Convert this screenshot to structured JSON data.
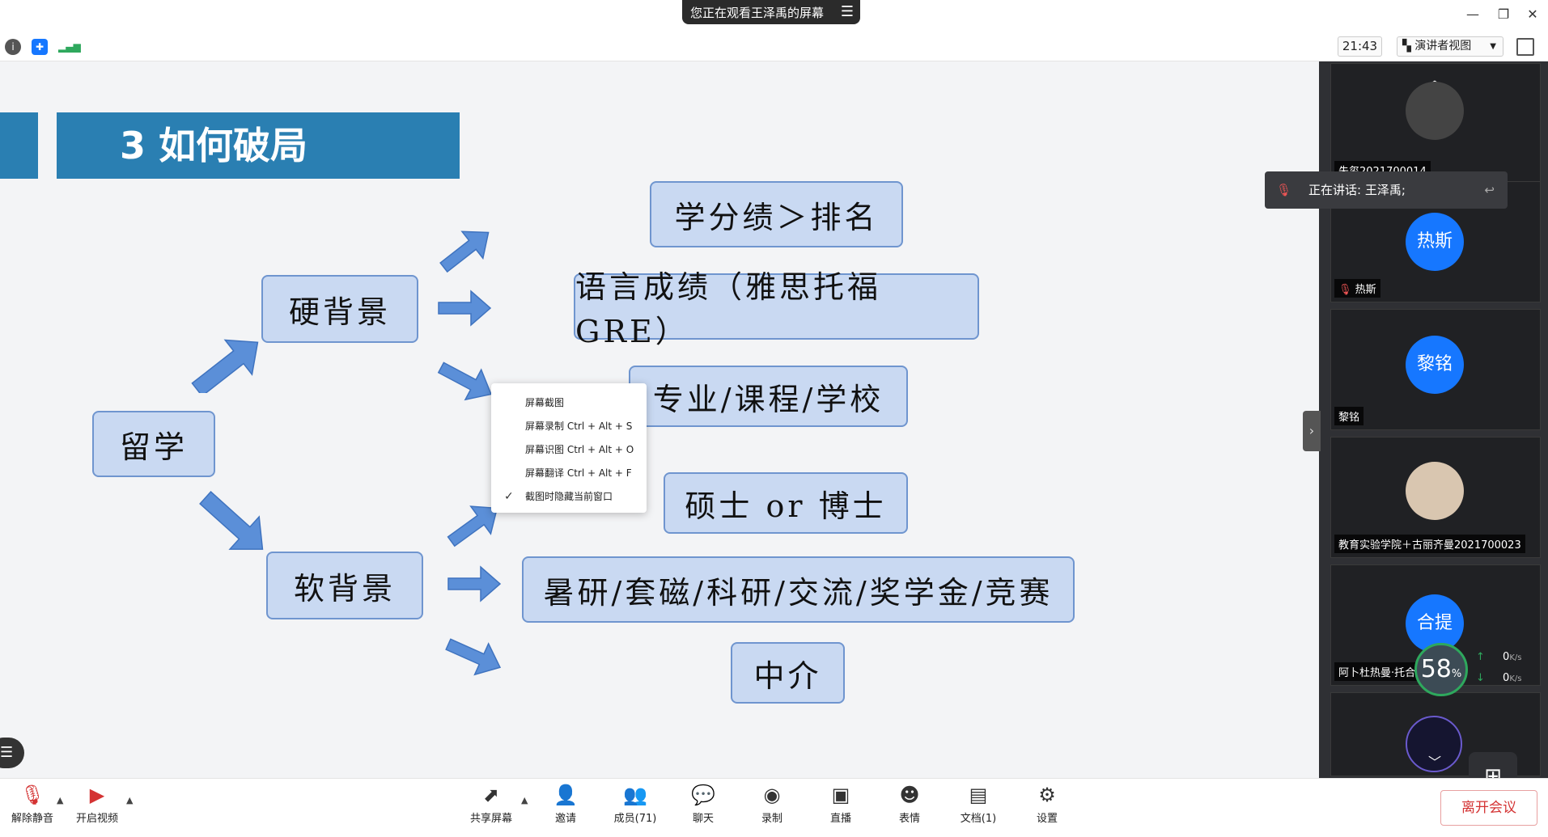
{
  "top": {
    "sharing_banner": "您正在观看王泽禹的屏幕",
    "clock": "21:43",
    "view_mode": "演讲者视图"
  },
  "slide": {
    "title": "3 如何破局",
    "root": "留学",
    "branches": [
      {
        "label": "硬背景",
        "items": [
          "学分绩＞排名",
          "语言成绩（雅思托福GRE）",
          "专业/课程/学校"
        ]
      },
      {
        "label": "软背景",
        "items": [
          "硕士 or 博士",
          "暑研/套磁/科研/交流/奖学金/竞赛",
          "中介"
        ]
      }
    ],
    "colors": {
      "title_bg": "#2a7fb2",
      "node_fill": "#c9d9f2",
      "node_border": "#6f95cf",
      "arrow": "#5b8fd8"
    }
  },
  "context_menu": {
    "items": [
      {
        "label": "屏幕截图",
        "checked": false
      },
      {
        "label": "屏幕录制 Ctrl + Alt + S",
        "checked": false
      },
      {
        "label": "屏幕识图 Ctrl + Alt + O",
        "checked": false
      },
      {
        "label": "屏幕翻译 Ctrl + Alt + F",
        "checked": false
      },
      {
        "label": "截图时隐藏当前窗口",
        "checked": true
      }
    ]
  },
  "panel": {
    "speaking": "正在讲话: 王泽禹;",
    "participants": [
      {
        "name": "朱玺2021700014",
        "avatar_text": ""
      },
      {
        "name": "热斯",
        "avatar_text": "热斯"
      },
      {
        "name": "黎铭",
        "avatar_text": "黎铭"
      },
      {
        "name": "教育实验学院＋古丽齐曼2021700023",
        "avatar_text": ""
      },
      {
        "name": "阿卜杜热曼·托合",
        "avatar_text": "合提"
      },
      {
        "name": "",
        "avatar_text": ""
      }
    ],
    "network": {
      "percent": "58",
      "percent_unit": "%",
      "up": "0",
      "down": "0",
      "unit": "K/s"
    }
  },
  "bottom": {
    "unmute": "解除静音",
    "video": "开启视频",
    "share": "共享屏幕",
    "invite": "邀请",
    "members": "成员(71)",
    "chat": "聊天",
    "record": "录制",
    "live": "直播",
    "emoji": "表情",
    "docs": "文档(1)",
    "settings": "设置",
    "leave": "离开会议"
  }
}
